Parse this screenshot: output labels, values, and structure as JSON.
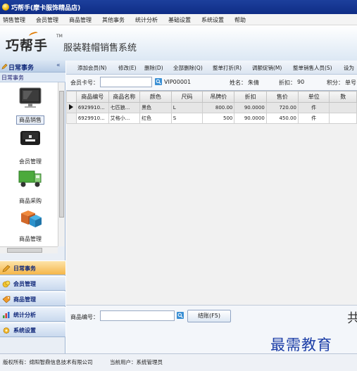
{
  "window": {
    "title": "巧帮手(摩卡服饰精品店)"
  },
  "menu": [
    "销售管理",
    "会员管理",
    "商品管理",
    "其他事务",
    "统计分析",
    "基础设置",
    "系统设置",
    "帮助"
  ],
  "banner": {
    "logo": "巧帮手",
    "tm": "TM",
    "subtitle": "服装鞋帽销售系统"
  },
  "left_panel": {
    "header": "日常事务",
    "collapse": "«",
    "sub_header": "日常事务",
    "icons": [
      {
        "label": "商品销售",
        "icon": "monitor-icon"
      },
      {
        "label": "会员管理",
        "icon": "card-reader-icon"
      },
      {
        "label": "商品采购",
        "icon": "truck-icon"
      },
      {
        "label": "商品管理",
        "icon": "boxes-icon"
      }
    ],
    "hscroll_label": "|||",
    "nav": [
      {
        "label": "日常事务",
        "icon": "pen-icon",
        "active": true
      },
      {
        "label": "会员管理",
        "icon": "coins-icon",
        "active": false
      },
      {
        "label": "商品管理",
        "icon": "tag-icon",
        "active": false
      },
      {
        "label": "统计分析",
        "icon": "chart-icon",
        "active": false
      },
      {
        "label": "系统设置",
        "icon": "gear-icon",
        "active": false
      }
    ]
  },
  "toolbar": [
    "添加会员(N)",
    "修改(E)",
    "删除(D)",
    "全部删除(Q)",
    "整单打折(R)",
    "调额促销(M)",
    "整单销售人员(S)",
    "设为"
  ],
  "info": {
    "card_label": "会员卡号：",
    "card_value": "VIP00001",
    "name_label": "姓名：",
    "name_value": "朱倩",
    "discount_label": "折扣：",
    "discount_value": "90",
    "points_label": "积分：",
    "points_value": "单号"
  },
  "table": {
    "columns": [
      "商品编号",
      "商品名称",
      "颜色",
      "尺码",
      "吊牌价",
      "折扣",
      "售价",
      "单位",
      "数"
    ],
    "rows": [
      {
        "selected": true,
        "cells": [
          "6929910...",
          "七匹狼...",
          "黑色",
          "L",
          "800.00",
          "90.0000",
          "720.00",
          "件",
          ""
        ]
      },
      {
        "selected": false,
        "cells": [
          "6929910...",
          "艾格小...",
          "红色",
          "S",
          "500",
          "90.0000",
          "450.00",
          "件",
          ""
        ]
      }
    ]
  },
  "bottom": {
    "code_label": "商品编号：",
    "settle_button": "结账(F5)",
    "big_text": "共",
    "watermark": "最需教育"
  },
  "status": {
    "copyright": "版权所有：绵阳智鼎信息技术有限公司",
    "user": "当前用户：系统管理员"
  },
  "colors": {
    "title_bar": "#143594",
    "nav_active": "#f5b64a",
    "accent_blue": "#10287a"
  }
}
